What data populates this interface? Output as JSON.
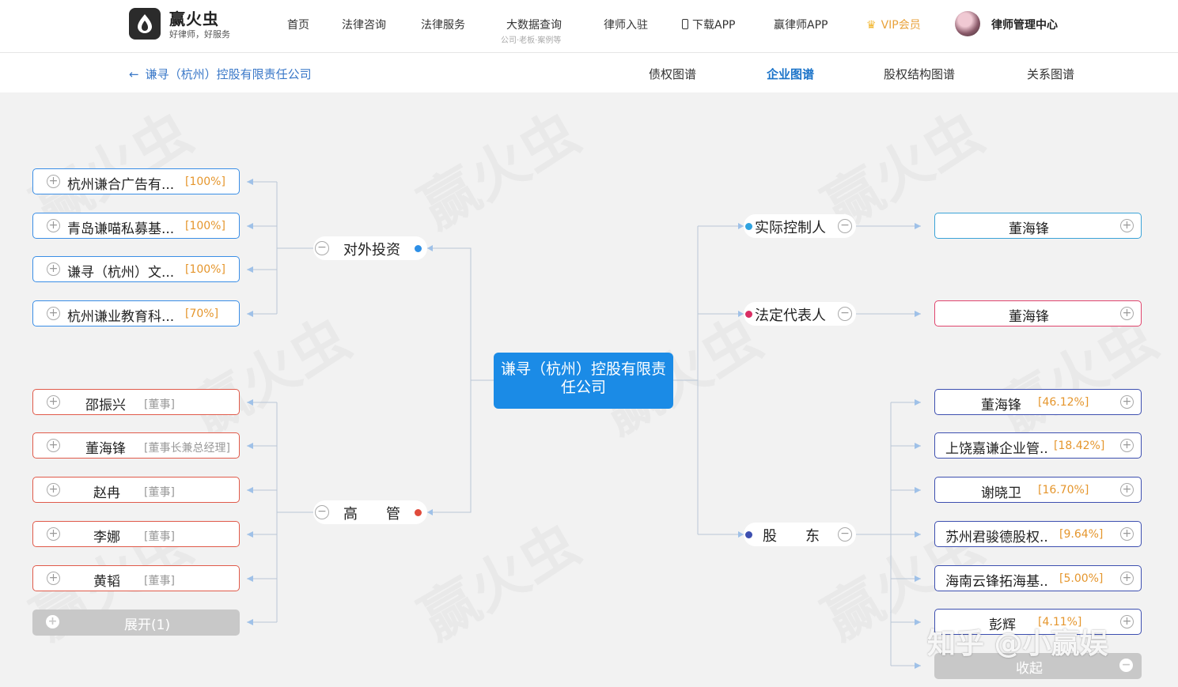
{
  "brand": {
    "name": "赢火虫",
    "slogan": "好律师，好服务"
  },
  "nav": {
    "items": [
      "首页",
      "法律咨询",
      "法律服务",
      "大数据查询",
      "律师入驻",
      "下载APP",
      "赢律师APP",
      "VIP会员"
    ],
    "bigdata_sub": "公司·老板·案例等",
    "lawyer_center": "律师管理中心"
  },
  "subnav": {
    "back": "谦寻（杭州）控股有限责任公司",
    "tabs": [
      "债权图谱",
      "企业图谱",
      "股权结构图谱",
      "关系图谱"
    ],
    "active_tab": "企业图谱"
  },
  "center": {
    "name": "谦寻（杭州）控股有限责任公司"
  },
  "left": {
    "investment": {
      "label": "对外投资",
      "items": [
        {
          "name": "杭州谦合广告有...",
          "pct": "[100%]"
        },
        {
          "name": "青岛谦喵私募基...",
          "pct": "[100%]"
        },
        {
          "name": "谦寻（杭州）文...",
          "pct": "[100%]"
        },
        {
          "name": "杭州谦业教育科...",
          "pct": "[70%]"
        }
      ]
    },
    "executives": {
      "label": "高　　管",
      "items": [
        {
          "name": "邵振兴",
          "role": "[董事]"
        },
        {
          "name": "董海锋",
          "role": "[董事长兼总经理]"
        },
        {
          "name": "赵冉",
          "role": "[董事]"
        },
        {
          "name": "李娜",
          "role": "[董事]"
        },
        {
          "name": "黄韬",
          "role": "[董事]"
        }
      ],
      "expand": "展开(1)"
    }
  },
  "right": {
    "controller": {
      "label": "实际控制人",
      "person": "董海锋"
    },
    "legal_rep": {
      "label": "法定代表人",
      "person": "董海锋"
    },
    "shareholders": {
      "label": "股　　东",
      "items": [
        {
          "name": "董海锋",
          "pct": "[46.12%]"
        },
        {
          "name": "上饶嘉谦企业管..",
          "pct": "[18.42%]"
        },
        {
          "name": "谢晓卫",
          "pct": "[16.70%]"
        },
        {
          "name": "苏州君骏德股权..",
          "pct": "[9.64%]"
        },
        {
          "name": "海南云锋拓海基..",
          "pct": "[5.00%]"
        },
        {
          "name": "彭辉",
          "pct": "[4.11%]"
        }
      ],
      "collapse": "收起"
    }
  },
  "watermark": {
    "brand": "赢火虫",
    "caption": "知乎 @小赢娱"
  },
  "colors": {
    "primary": "#1b8be6",
    "percent": "#e5962d",
    "exec_border": "#e05a4a",
    "invest_border": "#3a8ee6"
  }
}
